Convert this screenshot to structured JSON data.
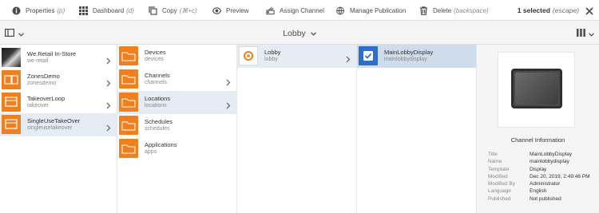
{
  "toolbar": {
    "properties": {
      "label": "Properties",
      "hint": "(p)"
    },
    "dashboard": {
      "label": "Dashboard",
      "hint": "(d)"
    },
    "copy": {
      "label": "Copy",
      "hint": "(⌘+c)"
    },
    "preview": {
      "label": "Preview"
    },
    "assign_channel": {
      "label": "Assign Channel"
    },
    "manage_publication": {
      "label": "Manage Publication"
    },
    "delete": {
      "label": "Delete",
      "hint": "(backspace)"
    },
    "selection": {
      "label": "1 selected",
      "hint": "(escape)"
    }
  },
  "breadcrumb": {
    "title": "Lobby"
  },
  "columns": {
    "col1": [
      {
        "title": "We.Retail In-Store",
        "subtitle": "we-retail"
      },
      {
        "title": "ZonesDemo",
        "subtitle": "zonesdemo"
      },
      {
        "title": "TakeoverLoop",
        "subtitle": "takeover"
      },
      {
        "title": "SingleUseTakeOver",
        "subtitle": "singleusetakeover"
      }
    ],
    "col2": [
      {
        "title": "Devices",
        "subtitle": "devices"
      },
      {
        "title": "Channels",
        "subtitle": "channels"
      },
      {
        "title": "Locations",
        "subtitle": "locations"
      },
      {
        "title": "Schedules",
        "subtitle": "schedules"
      },
      {
        "title": "Applications",
        "subtitle": "apps"
      }
    ],
    "col3": [
      {
        "title": "Lobby",
        "subtitle": "lobby"
      }
    ],
    "col4": [
      {
        "title": "MainLobbyDisplay",
        "subtitle": "mainlobbydisplay"
      }
    ]
  },
  "preview": {
    "heading": "Channel Information",
    "meta": [
      {
        "k": "Title",
        "v": "MainLobbyDisplay"
      },
      {
        "k": "Name",
        "v": "mainlobbydisplay"
      },
      {
        "k": "Template",
        "v": "Display"
      },
      {
        "k": "Modified",
        "v": "Dec 20, 2019, 2:49:46 PM"
      },
      {
        "k": "Modified By",
        "v": "Administrator"
      },
      {
        "k": "Language",
        "v": "English"
      },
      {
        "k": "Published",
        "v": "Not published"
      }
    ]
  },
  "colors": {
    "accent": "#f0801e",
    "selected_row": "#e5ecf3",
    "checked_blue": "#2d6dcc"
  }
}
